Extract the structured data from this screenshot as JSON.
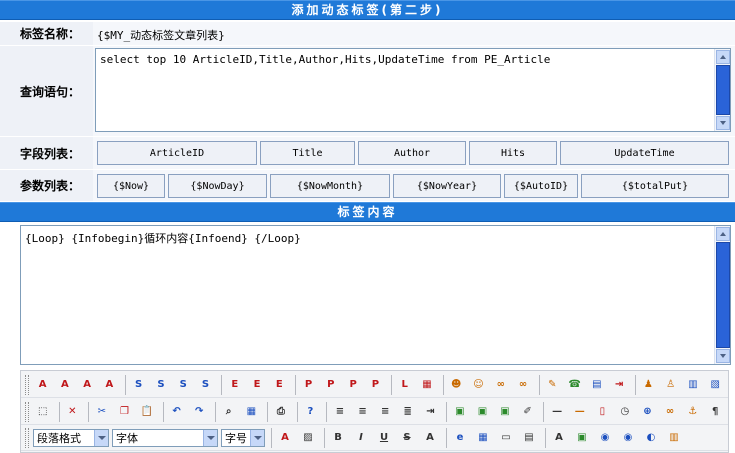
{
  "header": {
    "title": "添加动态标签(第二步)"
  },
  "form": {
    "name": {
      "label": "标签名称：",
      "value": "{$MY_动态标签文章列表}"
    },
    "query": {
      "label": "查询语句：",
      "value": "select top 10 ArticleID,Title,Author,Hits,UpdateTime from PE_Article"
    },
    "fields": {
      "label": "字段列表：",
      "items": [
        "ArticleID",
        "Title",
        "Author",
        "Hits",
        "UpdateTime"
      ]
    },
    "params": {
      "label": "参数列表：",
      "items": [
        "{$Now}",
        "{$NowDay}",
        "{$NowMonth}",
        "{$NowYear}",
        "{$AutoID}",
        "{$totalPut}"
      ]
    }
  },
  "content_section": {
    "title": "标签内容",
    "value": "{Loop} {Infobegin}循环内容{Infoend} {/Loop}"
  },
  "toolbar": {
    "paragraph_format": "段落格式",
    "font": "字体",
    "font_size": "字号"
  }
}
